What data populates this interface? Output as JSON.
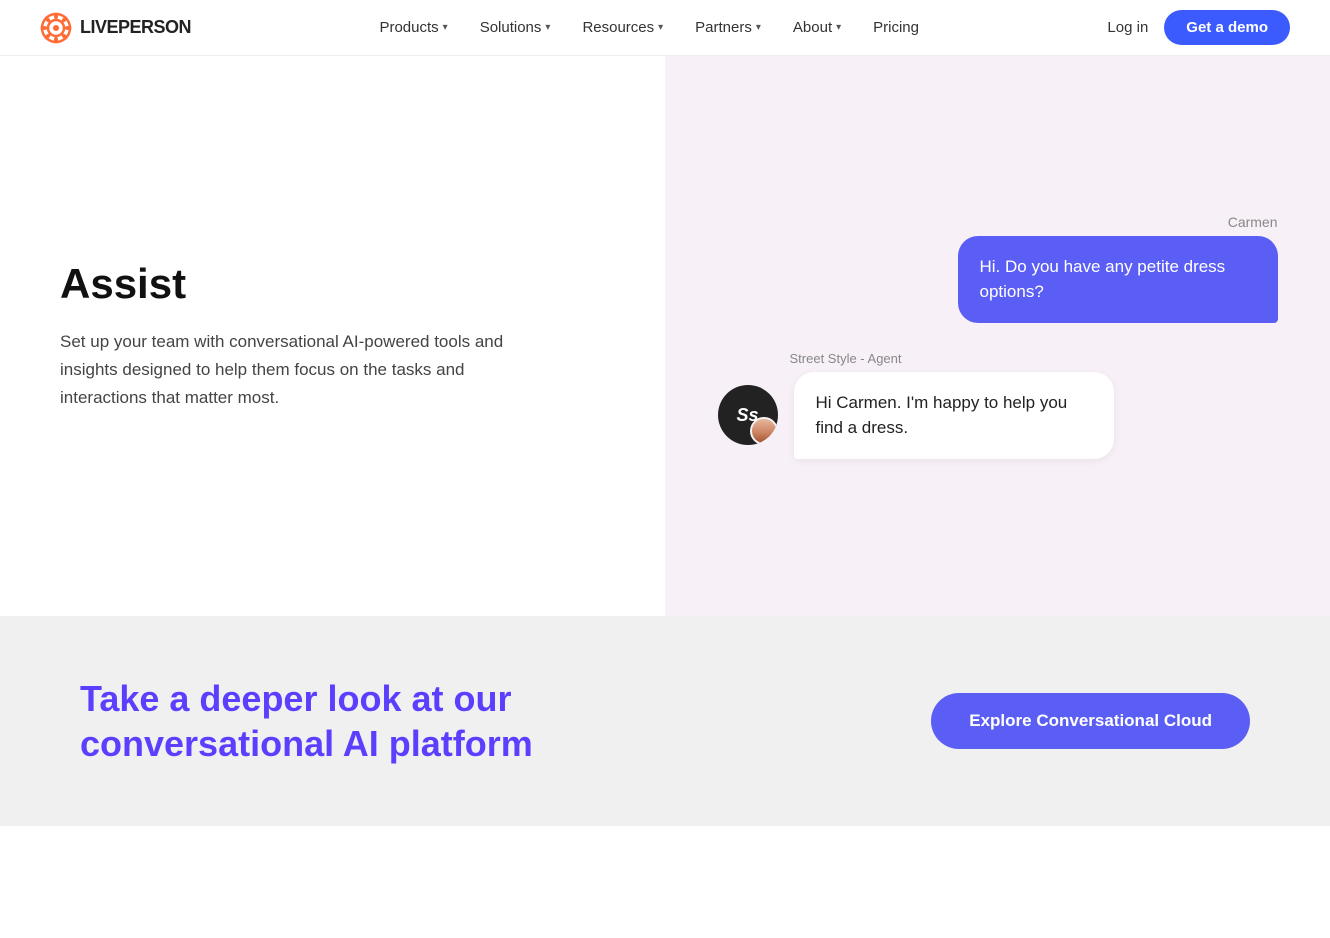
{
  "nav": {
    "logo_text": "LIVEPERSON",
    "items": [
      {
        "label": "Products",
        "has_dropdown": true
      },
      {
        "label": "Solutions",
        "has_dropdown": true
      },
      {
        "label": "Resources",
        "has_dropdown": true
      },
      {
        "label": "Partners",
        "has_dropdown": true
      },
      {
        "label": "About",
        "has_dropdown": true
      },
      {
        "label": "Pricing",
        "has_dropdown": false
      }
    ],
    "login_label": "Log in",
    "demo_label": "Get a demo"
  },
  "main": {
    "left": {
      "title": "Assist",
      "description": "Set up your team with conversational AI-powered tools and insights designed to help them focus on the tasks and interactions that matter most."
    },
    "right": {
      "user_name": "Carmen",
      "user_message": "Hi. Do you have any petite dress options?",
      "agent_label": "Street Style - Agent",
      "agent_message": "Hi Carmen. I'm happy to help you find a dress."
    }
  },
  "cta": {
    "title": "Take a deeper look at our conversational AI platform",
    "button_label": "Explore Conversational Cloud"
  },
  "colors": {
    "accent": "#5b3fff",
    "button_blue": "#3b5bff",
    "bubble_user": "#5b5ef4",
    "cta_bg": "#f0f0f0",
    "right_panel_bg": "#f7f0f7"
  }
}
